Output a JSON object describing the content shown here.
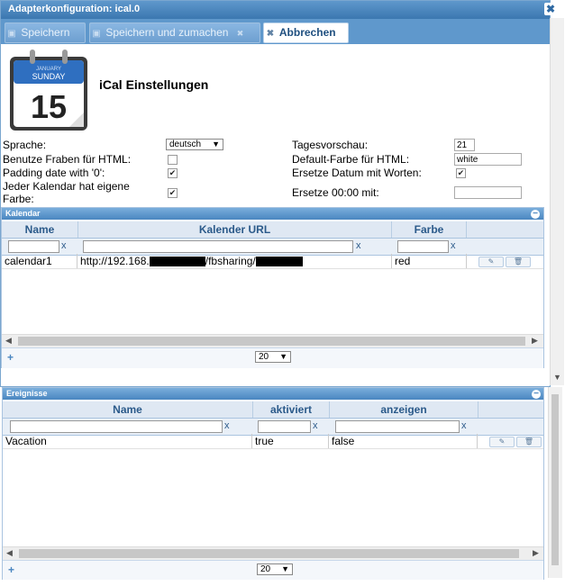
{
  "window": {
    "title": "Adapterkonfiguration: ical.0",
    "close_glyph": "✖"
  },
  "toolbar": {
    "save_label": "Speichern",
    "save_close_label": "Speichern und zumachen",
    "cancel_label": "Abbrechen",
    "cancel_x": "✖",
    "tab_x": "✖"
  },
  "calendar_icon": {
    "month": "JANUARY",
    "weekday": "SUNDAY",
    "day": "15"
  },
  "page_title": "iCal Einstellungen",
  "settings": {
    "language_label": "Sprache:",
    "language_value": "deutsch",
    "colors_html_label": "Benutze Fraben für HTML:",
    "padding_label": "Padding date with '0':",
    "own_color_label": "Jeder Kalendar hat eigene Farbe:",
    "preview_label": "Tagesvorschau:",
    "preview_value": "21",
    "default_color_label": "Default-Farbe für HTML:",
    "default_color_value": "white",
    "replace_date_label": "Ersetze Datum mit Worten:",
    "replace_midnight_label": "Ersetze 00:00 mit:",
    "replace_midnight_value": "",
    "colors_html_checked": false,
    "padding_checked": true,
    "own_color_checked": true,
    "replace_date_checked": true
  },
  "calendar_panel": {
    "title": "Kalendar",
    "columns": [
      "Name",
      "Kalender URL",
      "Farbe"
    ],
    "filter_clear": "x",
    "rows": [
      {
        "name": "calendar1",
        "url_start": "http://192.168.",
        "url_mid": "/fbsharing/",
        "color": "red"
      }
    ],
    "edit_glyph": "✎",
    "delete_glyph": "🗑",
    "add": "+",
    "page_size": "20"
  },
  "events_panel": {
    "title": "Ereignisse",
    "columns": [
      "Name",
      "aktiviert",
      "anzeigen"
    ],
    "filter_clear": "x",
    "rows": [
      {
        "name": "Vacation",
        "enabled": "true",
        "show": "false"
      }
    ],
    "add": "+",
    "page_size": "20"
  },
  "colors": {
    "header_blue": "#4a86c0",
    "accent": "#2b5a8a"
  }
}
